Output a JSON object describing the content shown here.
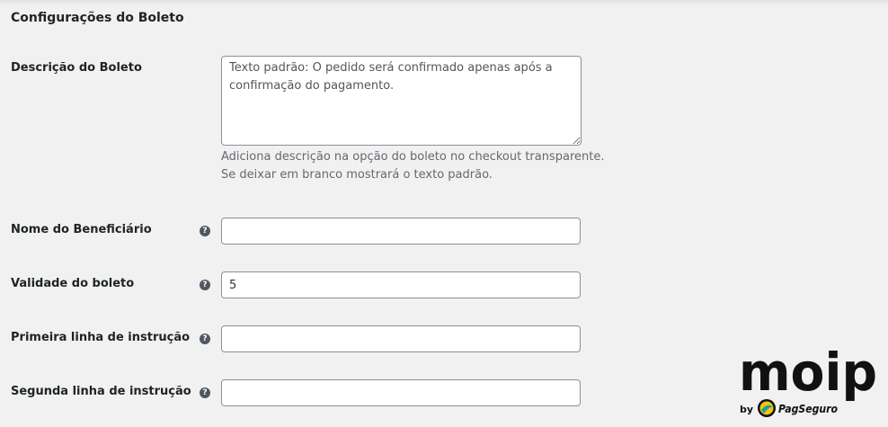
{
  "section": {
    "title": "Configurações do Boleto"
  },
  "fields": {
    "description": {
      "label": "Descrição do Boleto",
      "value": "Texto padrão: O pedido será confirmado apenas após a confirmação do pagamento.",
      "help_line1": "Adiciona descrição na opção do boleto no checkout transparente.",
      "help_line2": "Se deixar em branco mostrará o texto padrão."
    },
    "beneficiary": {
      "label": "Nome do Beneficiário",
      "value": ""
    },
    "validity": {
      "label": "Validade do boleto",
      "value": "5"
    },
    "instruction1": {
      "label": "Primeira linha de instrução",
      "value": ""
    },
    "instruction2": {
      "label": "Segunda linha de instrução",
      "value": ""
    }
  },
  "help_icon": {
    "icon": "question-circle-icon",
    "glyph": "?"
  },
  "logo": {
    "brand": "moip",
    "byline": "by",
    "partner": "PagSeguro",
    "colors": {
      "text": "#111111",
      "partner_yellow": "#f7c315",
      "partner_teal": "#1aa29a"
    }
  }
}
